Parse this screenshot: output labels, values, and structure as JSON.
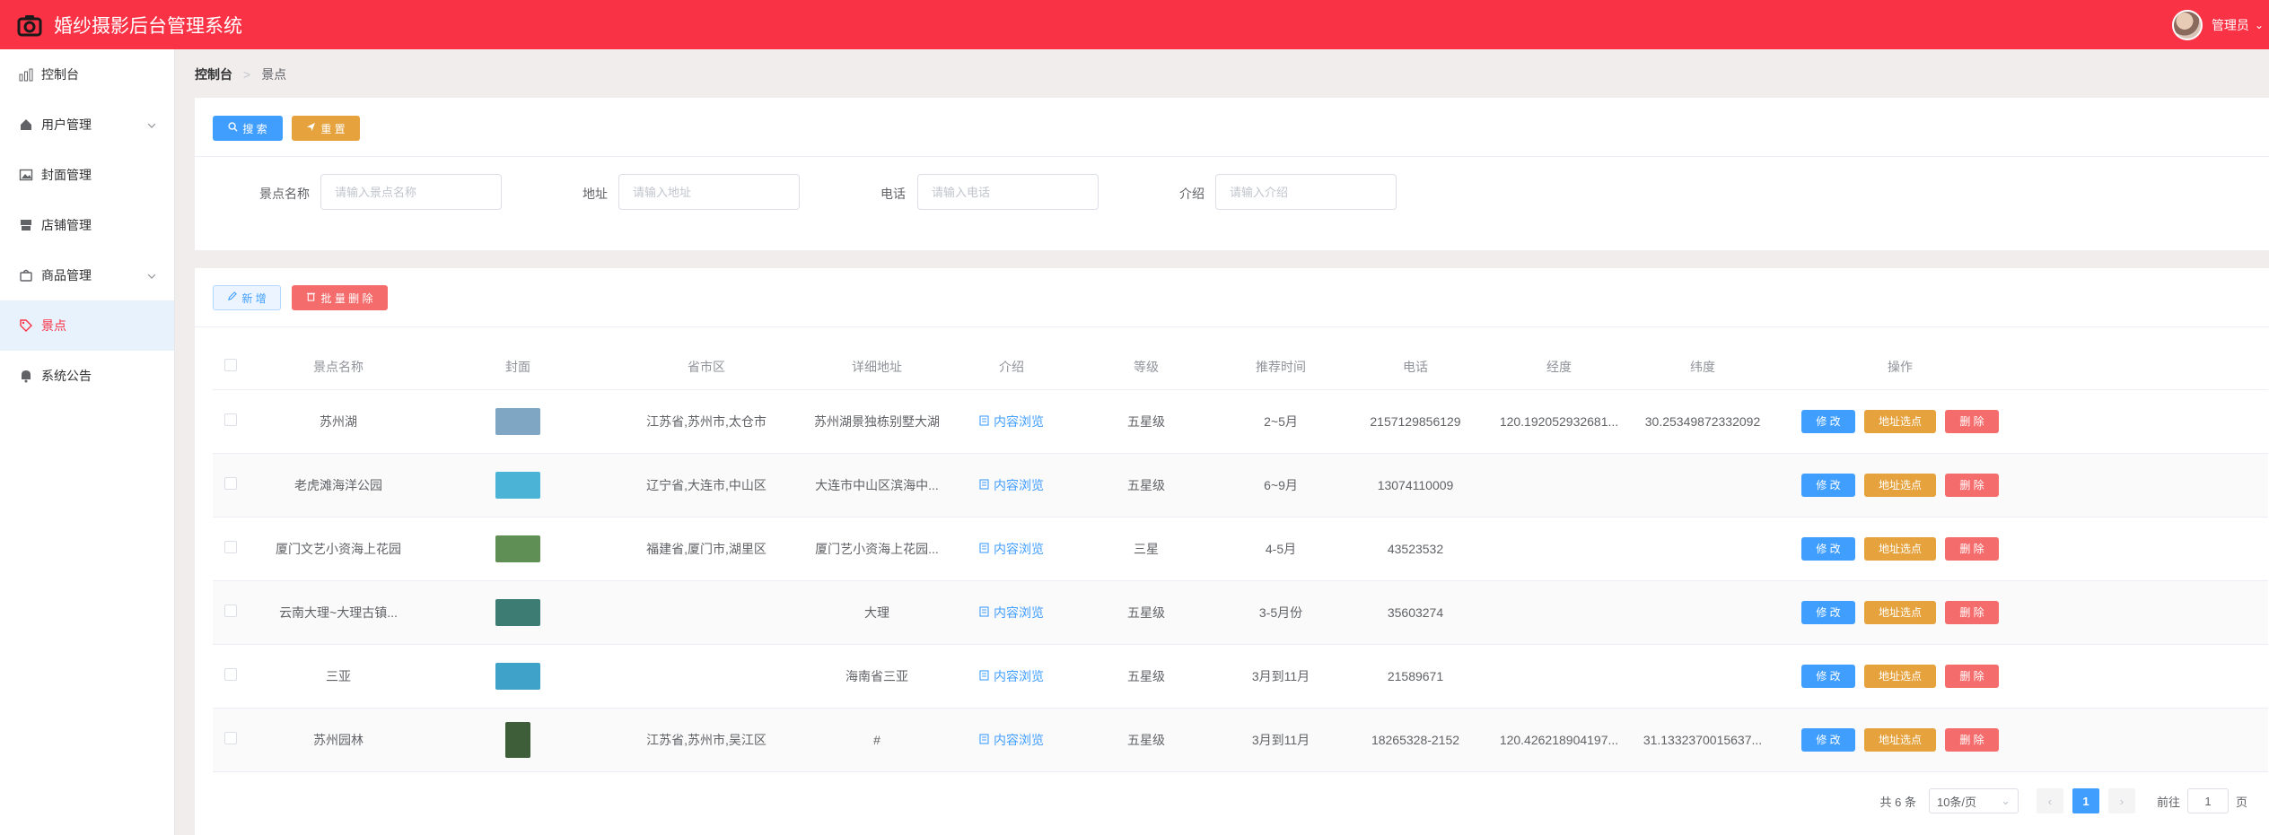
{
  "app": {
    "title": "婚纱摄影后台管理系统"
  },
  "user": {
    "name": "管理员"
  },
  "sidebar": {
    "items": [
      {
        "label": "控制台",
        "icon": "dashboard-icon"
      },
      {
        "label": "用户管理",
        "icon": "home-icon",
        "expandable": true
      },
      {
        "label": "封面管理",
        "icon": "image-icon"
      },
      {
        "label": "店铺管理",
        "icon": "shop-icon"
      },
      {
        "label": "商品管理",
        "icon": "bag-icon",
        "expandable": true
      },
      {
        "label": "景点",
        "icon": "tag-icon",
        "active": true
      },
      {
        "label": "系统公告",
        "icon": "bell-icon"
      }
    ]
  },
  "breadcrumb": {
    "home": "控制台",
    "current": "景点"
  },
  "toolbar": {
    "search_label": "搜 索",
    "reset_label": "重 置",
    "add_label": "新 增",
    "batch_delete_label": "批 量 删 除"
  },
  "filters": [
    {
      "label": "景点名称",
      "placeholder": "请输入景点名称"
    },
    {
      "label": "地址",
      "placeholder": "请输入地址"
    },
    {
      "label": "电话",
      "placeholder": "请输入电话"
    },
    {
      "label": "介绍",
      "placeholder": "请输入介绍"
    }
  ],
  "table": {
    "columns": [
      "景点名称",
      "封面",
      "省市区",
      "详细地址",
      "介绍",
      "等级",
      "推荐时间",
      "电话",
      "经度",
      "纬度",
      "操作"
    ],
    "intro_link_label": "内容浏览",
    "actions": {
      "edit": "修 改",
      "locate": "地址选点",
      "delete": "删 除"
    },
    "rows": [
      {
        "name": "苏州湖",
        "region": "江苏省,苏州市,太仓市",
        "address": "苏州湖景独栋别墅大湖",
        "level": "五星级",
        "time": "2~5月",
        "phone": "2157129856129",
        "lng": "120.192052932681...",
        "lat": "30.25349872332092",
        "thumb": "#7fa7c4"
      },
      {
        "name": "老虎滩海洋公园",
        "region": "辽宁省,大连市,中山区",
        "address": "大连市中山区滨海中...",
        "level": "五星级",
        "time": "6~9月",
        "phone": "13074110009",
        "lng": "",
        "lat": "",
        "thumb": "#4ab3d6"
      },
      {
        "name": "厦门文艺小资海上花园",
        "region": "福建省,厦门市,湖里区",
        "address": "厦门艺小资海上花园...",
        "level": "三星",
        "time": "4-5月",
        "phone": "43523532",
        "lng": "",
        "lat": "",
        "thumb": "#5f8f55"
      },
      {
        "name": "云南大理~大理古镇...",
        "region": "",
        "address": "大理",
        "level": "五星级",
        "time": "3-5月份",
        "phone": "35603274",
        "lng": "",
        "lat": "",
        "thumb": "#3d7c73"
      },
      {
        "name": "三亚",
        "region": "",
        "address": "海南省三亚",
        "level": "五星级",
        "time": "3月到11月",
        "phone": "21589671",
        "lng": "",
        "lat": "",
        "thumb": "#3fa3c9"
      },
      {
        "name": "苏州园林",
        "region": "江苏省,苏州市,吴江区",
        "address": "#",
        "level": "五星级",
        "time": "3月到11月",
        "phone": "18265328-2152",
        "lng": "120.426218904197...",
        "lat": "31.1332370015637...",
        "thumb": "#3e5e3a",
        "tall": true
      }
    ]
  },
  "pagination": {
    "total": "共 6 条",
    "page_size": "10条/页",
    "current_page": "1",
    "goto_prefix": "前往",
    "goto_value": "1",
    "goto_suffix": "页"
  }
}
